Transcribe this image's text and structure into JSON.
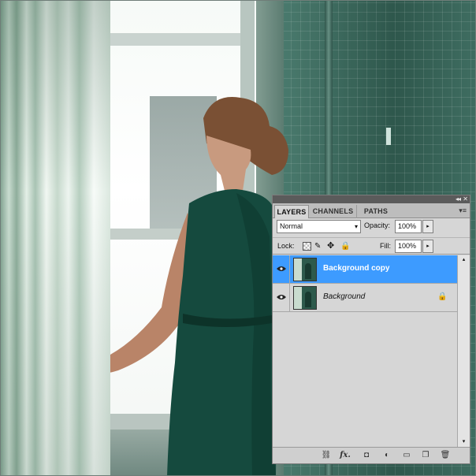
{
  "panel": {
    "tabs": [
      {
        "label": "LAYERS",
        "active": true
      },
      {
        "label": "CHANNELS",
        "active": false
      },
      {
        "label": "PATHS",
        "active": false
      }
    ],
    "collapse_glyph": "◂◂",
    "close_glyph": "✕",
    "menu_glyph": "▾≡",
    "blend_mode": "Normal",
    "dropdown_glyph": "▾",
    "stepper_glyph": "▸",
    "opacity_label": "Opacity:",
    "opacity_value": "100%",
    "lock_label": "Lock:",
    "fill_label": "Fill:",
    "fill_value": "100%",
    "layers": [
      {
        "name": "Background copy",
        "selected": true,
        "visible": true,
        "locked": false
      },
      {
        "name": "Background",
        "selected": false,
        "visible": true,
        "locked": true
      }
    ],
    "scroll_up_glyph": "▴",
    "scroll_down_glyph": "▾",
    "bottom_icons": {
      "link": "⛓",
      "fx": "fx.",
      "mask": "◘",
      "adjust": "◐",
      "folder": "▭",
      "new": "❐",
      "trash": "🗑"
    },
    "lock_icons": {
      "brush": "✎",
      "move": "✥",
      "all": "🔒"
    },
    "selected_color": "#3d9bff"
  }
}
